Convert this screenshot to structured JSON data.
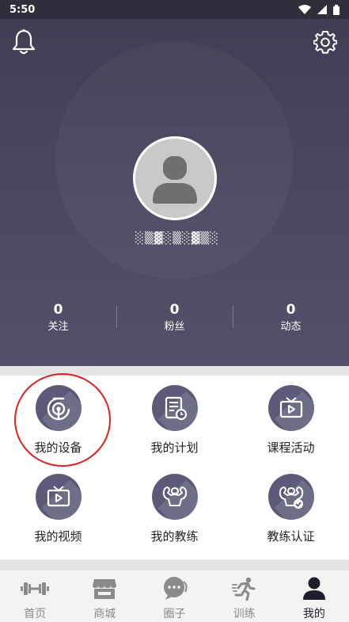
{
  "status_bar": {
    "time": "5:50"
  },
  "profile": {
    "username": "░▒▓░▒░▓▒░"
  },
  "stats": [
    {
      "value": "0",
      "label": "关注"
    },
    {
      "value": "0",
      "label": "粉丝"
    },
    {
      "value": "0",
      "label": "动态"
    }
  ],
  "grid": [
    {
      "label": "我的设备",
      "icon": "device-icon"
    },
    {
      "label": "我的计划",
      "icon": "plan-icon"
    },
    {
      "label": "课程活动",
      "icon": "course-tv-icon"
    },
    {
      "label": "我的视频",
      "icon": "video-tv-icon"
    },
    {
      "label": "我的教练",
      "icon": "coach-muscle-icon"
    },
    {
      "label": "教练认证",
      "icon": "coach-cert-icon"
    }
  ],
  "bottom_nav": [
    {
      "label": "首页",
      "icon": "dumbbell-icon",
      "active": false
    },
    {
      "label": "商城",
      "icon": "shop-icon",
      "active": false
    },
    {
      "label": "圈子",
      "icon": "chat-bubble-icon",
      "active": false
    },
    {
      "label": "训练",
      "icon": "runner-icon",
      "active": false
    },
    {
      "label": "我的",
      "icon": "user-icon",
      "active": true
    }
  ],
  "colors": {
    "header_bg": "#4b4962",
    "accent_circle": "#5c5a78",
    "highlight": "#e02020"
  }
}
